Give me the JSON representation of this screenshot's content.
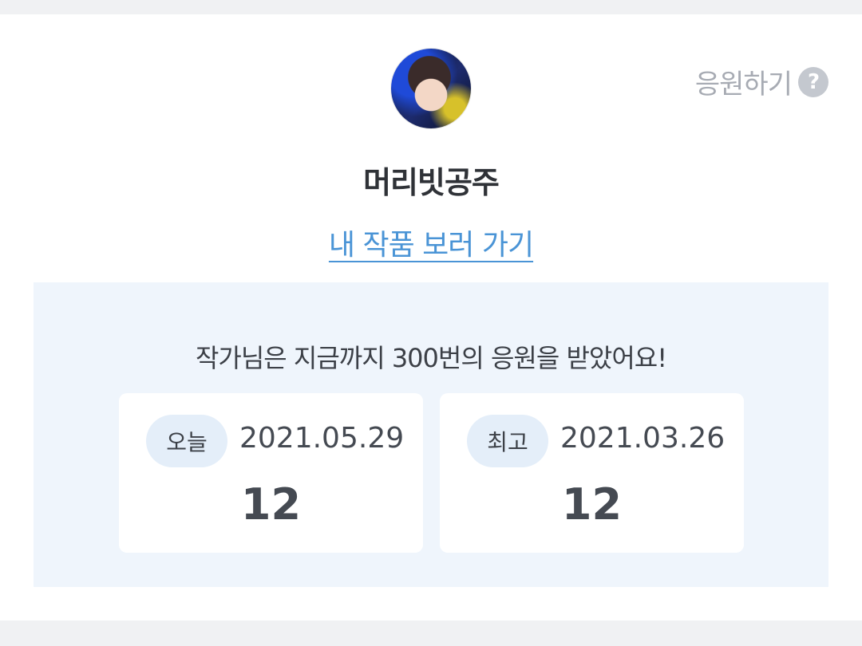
{
  "support": {
    "label": "응원하기",
    "help_symbol": "?",
    "help_icon": "question-circle-icon"
  },
  "author": {
    "name": "머리빗공주",
    "works_link": "내 작품 보러 가기"
  },
  "stats": {
    "summary": "작가님은 지금까지 300번의 응원을 받았어요!",
    "today": {
      "tag": "오늘",
      "date": "2021.05.29",
      "count": "12"
    },
    "best": {
      "tag": "최고",
      "date": "2021.03.26",
      "count": "12"
    }
  },
  "colors": {
    "accent_link": "#4a94d6",
    "panel_bg": "#eff5fc",
    "tag_bg": "#e4eef9",
    "muted": "#a7abb3"
  }
}
